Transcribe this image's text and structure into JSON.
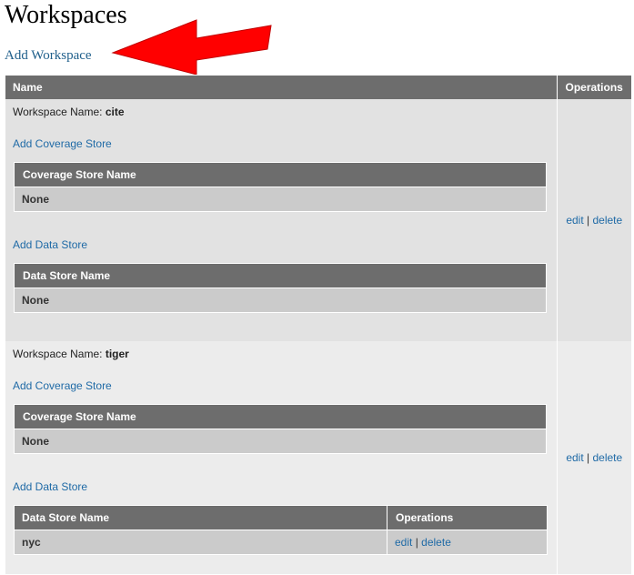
{
  "page": {
    "title": "Workspaces",
    "add_workspace": "Add Workspace",
    "accent_arrow_color": "#ff0000"
  },
  "table": {
    "headers": {
      "name": "Name",
      "operations": "Operations"
    }
  },
  "workspaces": [
    {
      "label": "Workspace Name:",
      "name": "cite",
      "add_coverage_store": "Add Coverage Store",
      "coverage_header": "Coverage Store Name",
      "coverage_value": "None",
      "add_data_store": "Add Data Store",
      "data_header": "Data Store Name",
      "data_value": "None",
      "edit": "edit",
      "sep": "|",
      "delete": "delete"
    },
    {
      "label": "Workspace Name:",
      "name": "tiger",
      "add_coverage_store": "Add Coverage Store",
      "coverage_header": "Coverage Store Name",
      "coverage_value": "None",
      "add_data_store": "Add Data Store",
      "data_header": "Data Store Name",
      "data_ops_header": "Operations",
      "data_value": "nyc",
      "data_edit": "edit",
      "data_sep": "|",
      "data_delete": "delete",
      "edit": "edit",
      "sep": "|",
      "delete": "delete"
    }
  ],
  "icons": {
    "annotation": "red-arrow-icon"
  }
}
